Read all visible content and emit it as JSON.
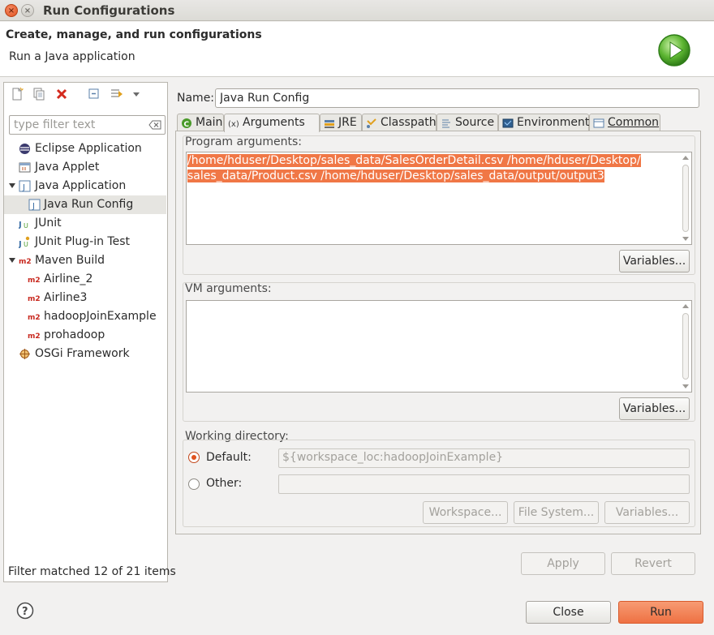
{
  "window": {
    "title": "Run Configurations"
  },
  "banner": {
    "title": "Create, manage, and run configurations",
    "subtitle": "Run a Java application"
  },
  "left": {
    "filter_placeholder": "type filter text",
    "tree": [
      {
        "label": "Eclipse Application",
        "icon": "eclipse-icon"
      },
      {
        "label": "Java Applet",
        "icon": "applet-icon"
      },
      {
        "label": "Java Application",
        "icon": "java-app-icon",
        "expanded": true
      },
      {
        "label": "Java Run Config",
        "icon": "java-config-icon",
        "selected": true
      },
      {
        "label": "JUnit",
        "icon": "junit-icon"
      },
      {
        "label": "JUnit Plug-in Test",
        "icon": "junit-plugin-icon"
      },
      {
        "label": "Maven Build",
        "icon": "maven-icon",
        "expanded": true
      },
      {
        "label": "Airline_2",
        "icon": "maven-icon"
      },
      {
        "label": "Airline3",
        "icon": "maven-icon"
      },
      {
        "label": "hadoopJoinExample",
        "icon": "maven-icon"
      },
      {
        "label": "prohadoop",
        "icon": "maven-icon"
      },
      {
        "label": "OSGi Framework",
        "icon": "osgi-icon"
      }
    ],
    "status": "Filter matched 12 of 21 items"
  },
  "right": {
    "name_label": "Name:",
    "name_value": "Java Run Config",
    "tabs": [
      "Main",
      "Arguments",
      "JRE",
      "Classpath",
      "Source",
      "Environment",
      "Common"
    ],
    "active_tab": "Arguments",
    "program_args_label": "Program arguments:",
    "program_args_line1": "/home/hduser/Desktop/sales_data/SalesOrderDetail.csv /home/hduser/Desktop/",
    "program_args_line2": "sales_data/Product.csv  /home/hduser/Desktop/sales_data/output/output3",
    "vm_args_label": "VM arguments:",
    "variables_label": "Variables...",
    "working_dir_label": "Working directory:",
    "default_label": "Default:",
    "default_value": "${workspace_loc:hadoopJoinExample}",
    "other_label": "Other:",
    "workspace_btn": "Workspace...",
    "filesystem_btn": "File System...",
    "apply_label": "Apply",
    "revert_label": "Revert"
  },
  "footer": {
    "close_label": "Close",
    "run_label": "Run"
  },
  "colors": {
    "accent": "#ee7143",
    "selection": "#f07746"
  }
}
